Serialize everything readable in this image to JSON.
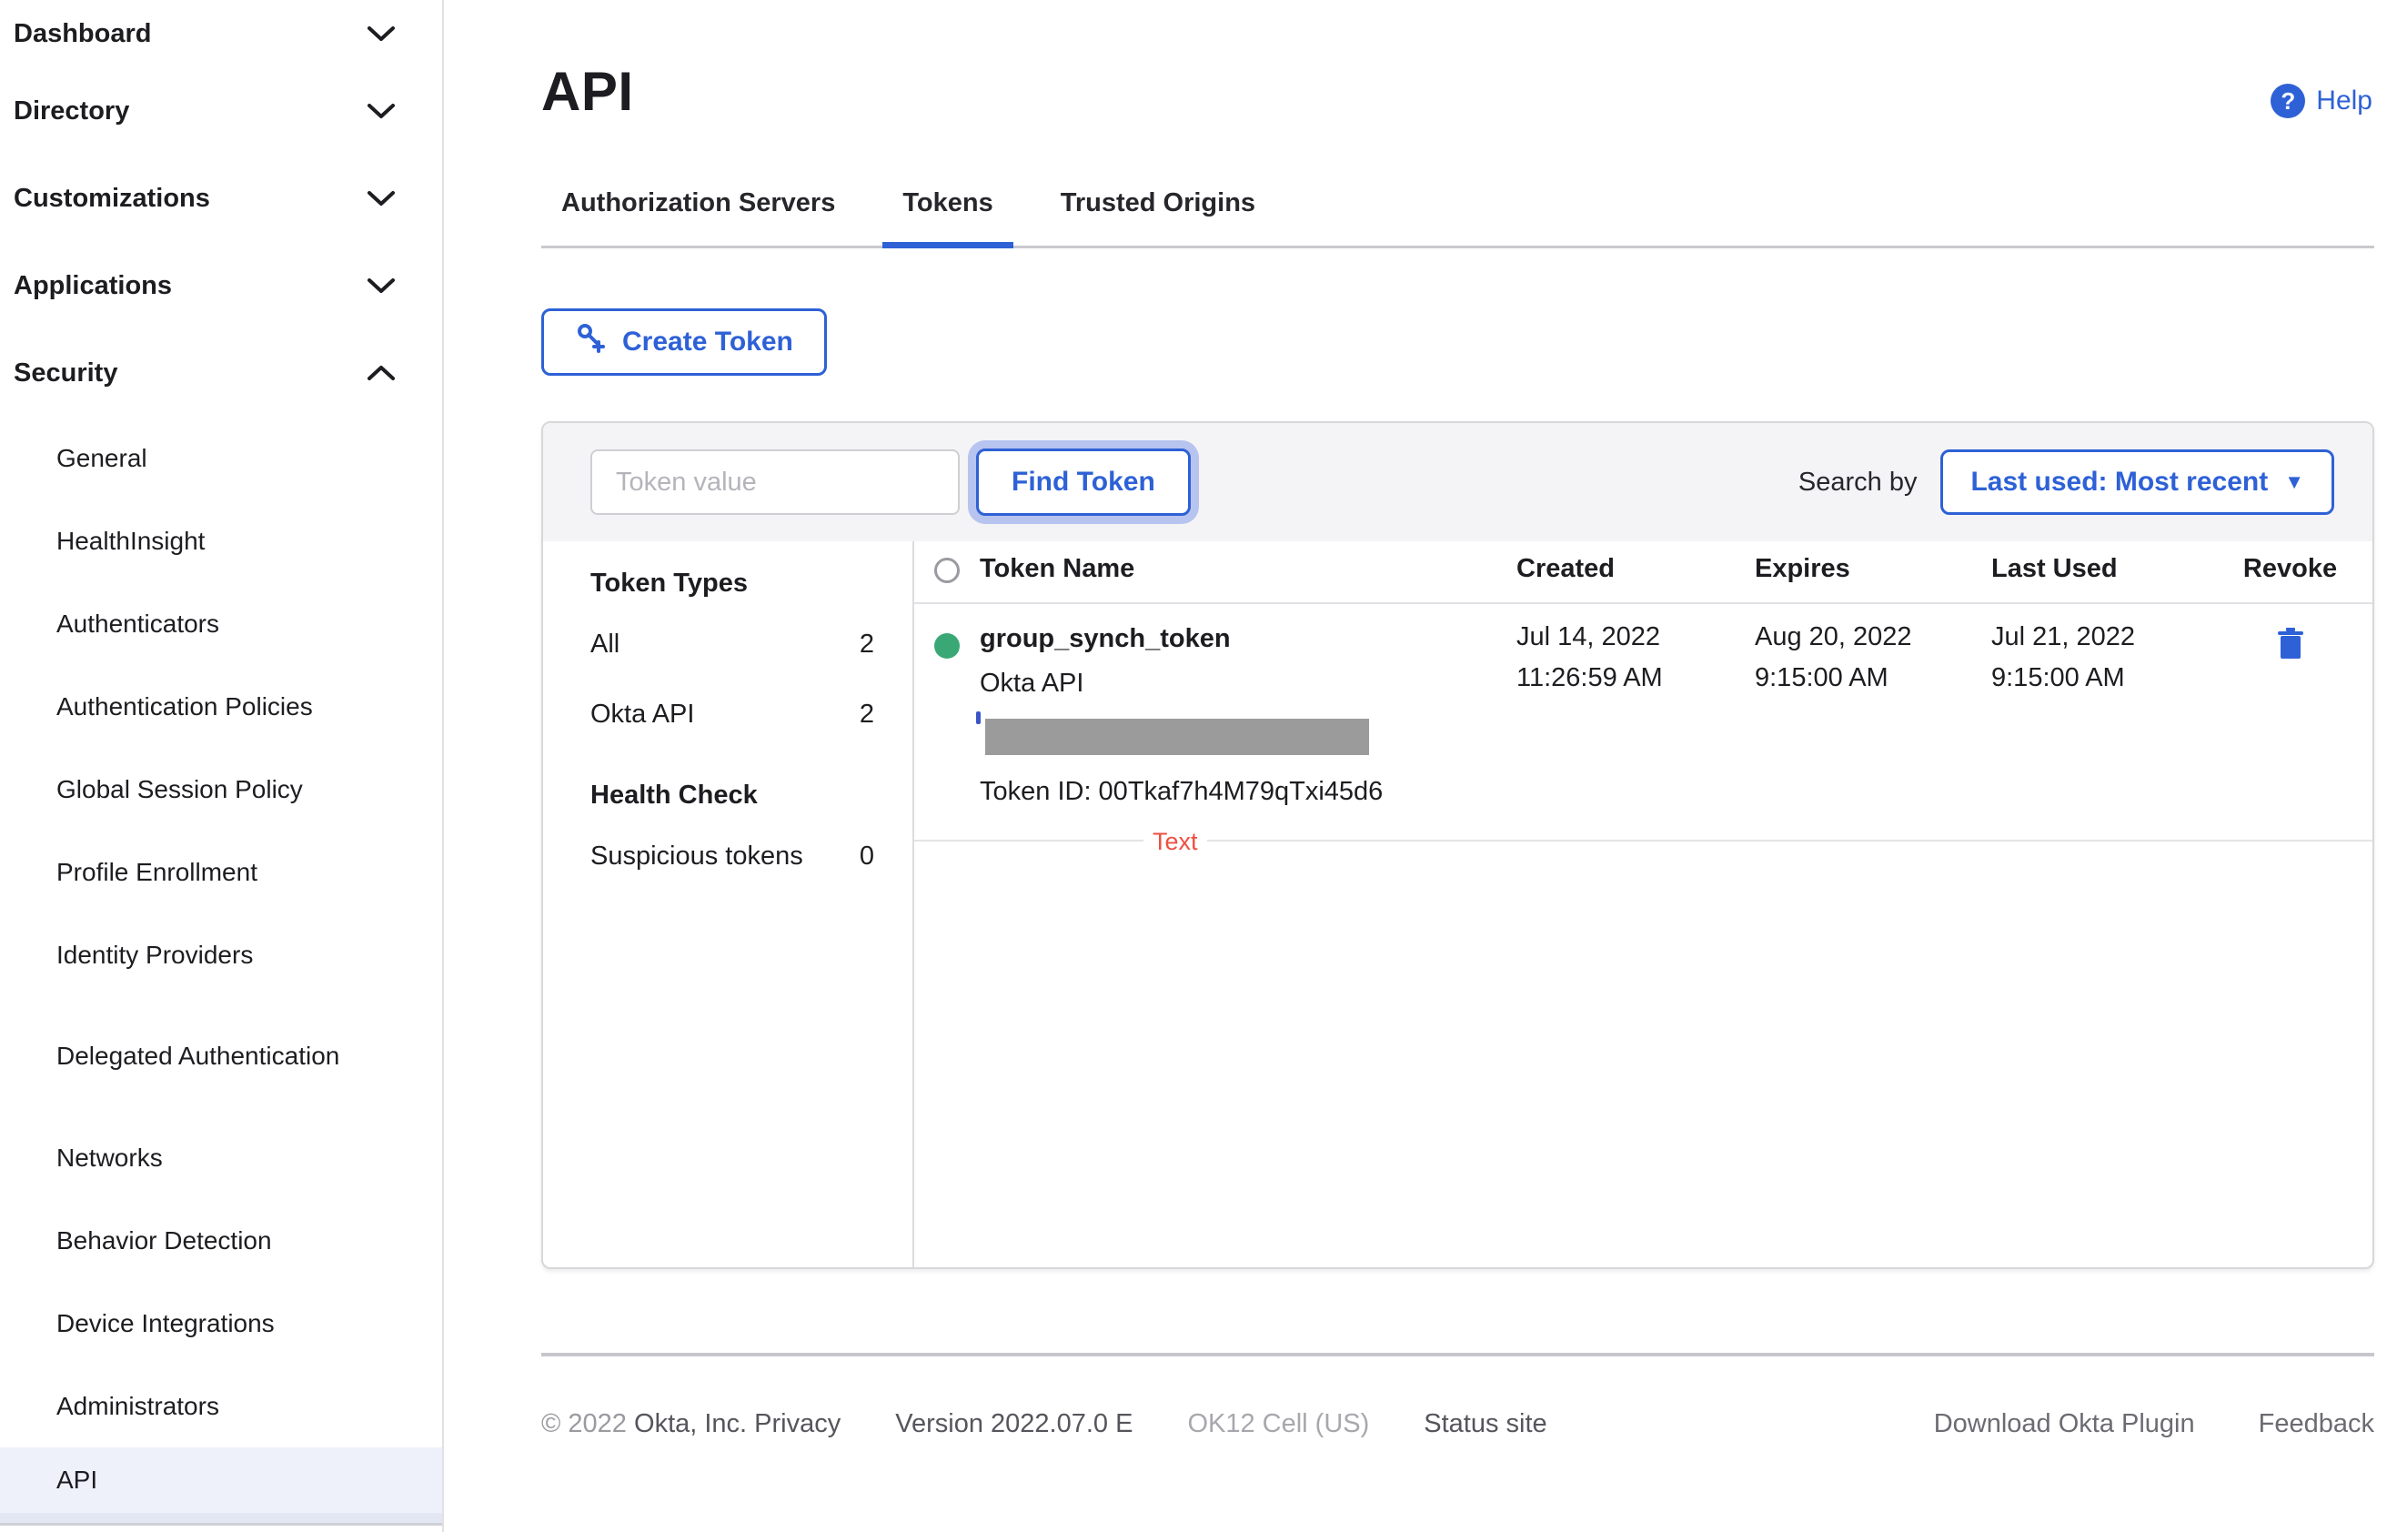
{
  "colors": {
    "accent": "#2e61d6",
    "status_active_green": "#3aa875",
    "annotation_red": "#ee5042",
    "active_nav_bg": "#eef1fa"
  },
  "sidebar": {
    "top_items": [
      {
        "label": "Dashboard",
        "chevron": "down"
      },
      {
        "label": "Directory",
        "chevron": "down"
      },
      {
        "label": "Customizations",
        "chevron": "down"
      },
      {
        "label": "Applications",
        "chevron": "down"
      },
      {
        "label": "Security",
        "chevron": "up"
      }
    ],
    "sub_items": [
      {
        "label": "General"
      },
      {
        "label": "HealthInsight"
      },
      {
        "label": "Authenticators"
      },
      {
        "label": "Authentication Policies"
      },
      {
        "label": "Global Session Policy"
      },
      {
        "label": "Profile Enrollment"
      },
      {
        "label": "Identity Providers"
      },
      {
        "label": "Delegated Authentication"
      },
      {
        "label": "Networks"
      },
      {
        "label": "Behavior Detection"
      },
      {
        "label": "Device Integrations"
      },
      {
        "label": "Administrators"
      },
      {
        "label": "API",
        "active": true
      }
    ]
  },
  "header": {
    "title": "API",
    "help_label": "Help",
    "help_icon": "?"
  },
  "tabs": [
    {
      "label": "Authorization Servers",
      "active": false
    },
    {
      "label": "Tokens",
      "active": true
    },
    {
      "label": "Trusted Origins",
      "active": false
    }
  ],
  "toolbar": {
    "create_token_label": "Create Token"
  },
  "search": {
    "placeholder": "Token value",
    "find_button": "Find Token",
    "search_by_label": "Search by",
    "sort_dropdown": "Last used: Most recent",
    "sort_caret": "▼"
  },
  "filters": {
    "token_types_title": "Token Types",
    "items": [
      {
        "label": "All",
        "count": "2"
      },
      {
        "label": "Okta API",
        "count": "2"
      }
    ],
    "health_check_title": "Health Check",
    "health_items": [
      {
        "label": "Suspicious tokens",
        "count": "0"
      }
    ]
  },
  "table": {
    "headers": [
      "Token Name",
      "Created",
      "Expires",
      "Last Used",
      "Revoke"
    ],
    "rows": [
      {
        "name": "group_synch_token",
        "type": "Okta API",
        "token_id": "Token ID: 00Tkaf7h4M79qTxi45d6",
        "created_date": "Jul 14, 2022",
        "created_time": "11:26:59 AM",
        "expires_date": "Aug 20, 2022",
        "expires_time": "9:15:00 AM",
        "last_used_date": "Jul 21, 2022",
        "last_used_time": "9:15:00 AM"
      }
    ],
    "annotation": "Text"
  },
  "footer": {
    "copyright": "© 2022",
    "company_privacy": "Okta, Inc. Privacy",
    "version": "Version 2022.07.0 E",
    "cell": "OK12 Cell (US)",
    "status": "Status site",
    "download": "Download Okta Plugin",
    "feedback": "Feedback"
  }
}
